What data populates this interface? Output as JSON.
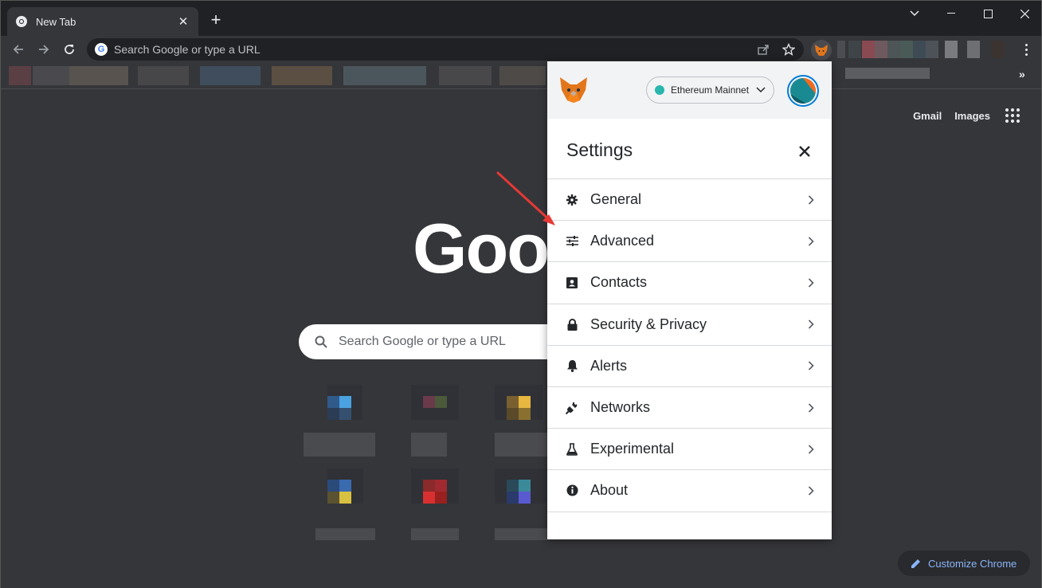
{
  "browser": {
    "tab_title": "New Tab",
    "omnibox_placeholder": "Search Google or type a URL"
  },
  "newtab": {
    "gmail_label": "Gmail",
    "images_label": "Images",
    "logo_text": "Goo",
    "search_placeholder": "Search Google or type a URL",
    "customize_label": "Customize Chrome"
  },
  "metamask": {
    "network_label": "Ethereum Mainnet",
    "network_color": "#29b6af",
    "settings_title": "Settings",
    "menu": [
      {
        "label": "General",
        "icon": "gear-icon"
      },
      {
        "label": "Advanced",
        "icon": "sliders-icon"
      },
      {
        "label": "Contacts",
        "icon": "contact-book-icon"
      },
      {
        "label": "Security & Privacy",
        "icon": "lock-icon"
      },
      {
        "label": "Alerts",
        "icon": "bell-icon"
      },
      {
        "label": "Networks",
        "icon": "plug-icon"
      },
      {
        "label": "Experimental",
        "icon": "flask-icon"
      },
      {
        "label": "About",
        "icon": "info-icon"
      }
    ]
  },
  "colors": {
    "accent": "#037dd6",
    "annotation_arrow": "#e53935",
    "link_blue": "#8ab4f8"
  }
}
